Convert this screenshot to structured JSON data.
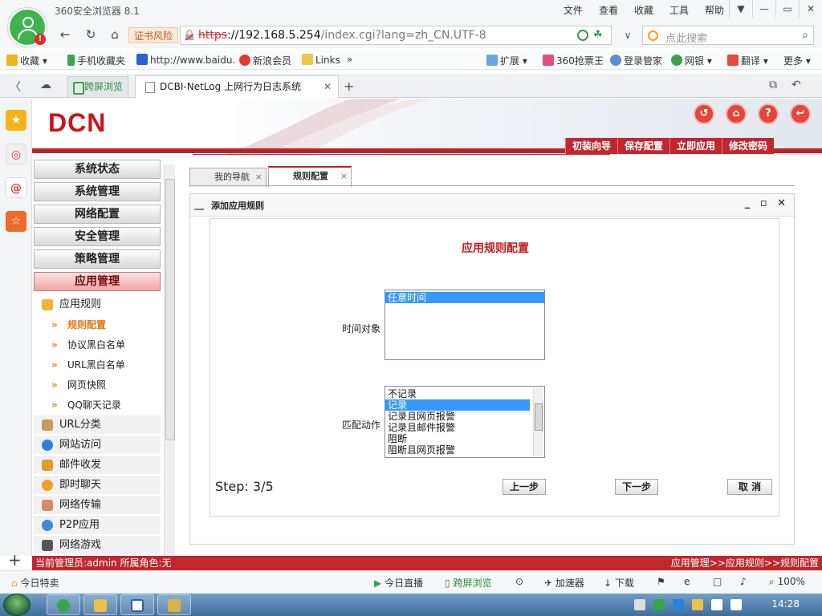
{
  "browser": {
    "app_title": "360安全浏览器 8.1",
    "menu": [
      "文件",
      "查看",
      "收藏",
      "工具",
      "帮助"
    ],
    "window_buttons": [
      "▼",
      "—",
      "▭",
      "✕"
    ],
    "avatar_badge": "!",
    "cert_warning": "证书风险",
    "url_protocol": "https",
    "url_host": "://192.168.5.254",
    "url_path": "/index.cgi?lang=zh_CN.UTF-8",
    "search_placeholder": "点此搜索",
    "bookmarks_left": [
      "收藏",
      "手机收藏夹",
      "http://www.baidu.",
      "新浪会员",
      "Links",
      "»"
    ],
    "bookmarks_right": [
      "扩展",
      "360抢票王",
      "登录管家",
      "网银",
      "翻译",
      "更多"
    ],
    "tab_split": "跨屏浏览",
    "tab_main": "DCBI-NetLog 上网行为日志系统",
    "tab_close": "✕",
    "tab_new": "+",
    "status_items": [
      "今日特卖",
      "今日直播",
      "跨屏浏览",
      "加速器",
      "下载",
      "100%"
    ]
  },
  "app": {
    "logo": "DCN",
    "header_icons": [
      "↺",
      "⌂",
      "?",
      "↩"
    ],
    "top_nav": [
      "初装向导",
      "保存配置",
      "立即应用",
      "修改密码"
    ],
    "menu_headers": [
      "系统状态",
      "系统管理",
      "网络配置",
      "安全管理",
      "策略管理",
      "应用管理"
    ],
    "menu_group": "应用规则",
    "menu_subitems": [
      "规则配置",
      "协议黑白名单",
      "URL黑白名单",
      "网页快照",
      "QQ聊天记录"
    ],
    "menu_more": [
      "URL分类",
      "网站访问",
      "邮件收发",
      "即时聊天",
      "网络传输",
      "P2P应用",
      "网络游戏"
    ],
    "content_tabs": [
      "我的导航",
      "规则配置"
    ],
    "dialog_title": "添加应用规则",
    "dialog_controls": "_ ▫ ✕",
    "form_title": "应用规则配置",
    "time_label": "时间对象",
    "time_options": [
      "任意时间"
    ],
    "action_label": "匹配动作",
    "action_options": [
      "不记录",
      "记录",
      "记录且网页报警",
      "记录且邮件报警",
      "阻断",
      "阻断且网页报警"
    ],
    "action_selected": "记录",
    "step": "Step: 3/5",
    "btn_prev": "上一步",
    "btn_next": "下一步",
    "btn_cancel": "取  消",
    "status_left": "当前管理员:admin  所属角色:无",
    "status_right": "应用管理>>应用规则>>规则配置"
  },
  "taskbar": {
    "clock": "14:28"
  },
  "colors": {
    "brand_red": "#c0282e",
    "logo_red": "#c8151b",
    "selection_blue": "#3399ff",
    "active_submenu": "#e27a12"
  }
}
